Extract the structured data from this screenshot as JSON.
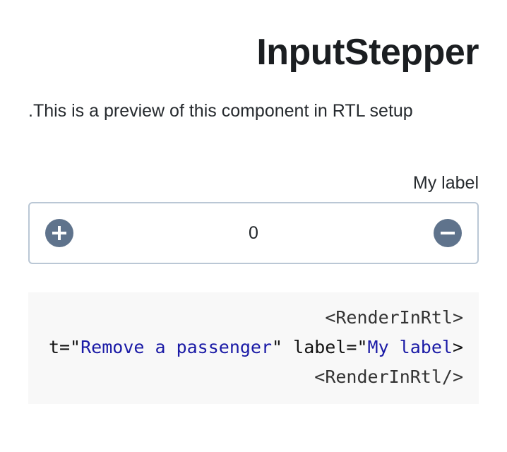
{
  "page": {
    "title": "InputStepper",
    "description": ".This is a preview of this component in RTL setup"
  },
  "stepper": {
    "label": "My label",
    "value": "0",
    "increment_icon": "plus-icon",
    "decrement_icon": "minus-icon",
    "colors": {
      "button": "#5f738c",
      "border": "#bac7d5"
    }
  },
  "code": {
    "line1": "<RenderInRtl>",
    "line2_prefix": "t=\"",
    "line2_value1": "Remove a passenger",
    "line2_mid": "\" label=\"",
    "line2_value2": "My label",
    "line2_suffix": ">",
    "line3": "<RenderInRtl/>",
    "colors": {
      "background": "#f8f8f8",
      "string": "#1a1aa6"
    }
  }
}
